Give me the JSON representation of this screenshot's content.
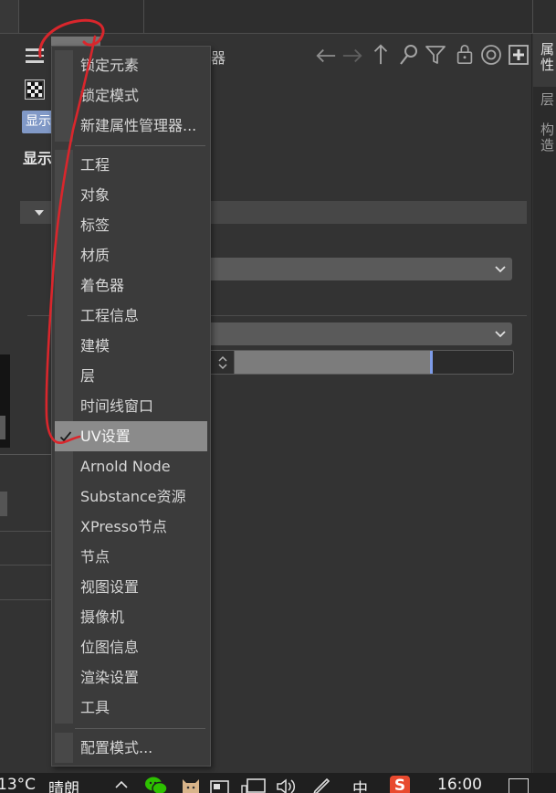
{
  "side_tabs": {
    "attributes": "属性",
    "layers": "层",
    "structure": "构造"
  },
  "toolbar": {
    "title_fragment": "器"
  },
  "mode_button": {
    "label": "显示"
  },
  "section": {
    "heading": "显示"
  },
  "slider": {
    "fill_fraction": 0.7
  },
  "menu": {
    "items": [
      {
        "label": "锁定元素"
      },
      {
        "label": "锁定模式"
      },
      {
        "label": "新建属性管理器..."
      },
      {
        "label": "工程"
      },
      {
        "label": "对象"
      },
      {
        "label": "标签"
      },
      {
        "label": "材质"
      },
      {
        "label": "着色器"
      },
      {
        "label": "工程信息"
      },
      {
        "label": "建模"
      },
      {
        "label": "层"
      },
      {
        "label": "时间线窗口"
      },
      {
        "label": "UV设置",
        "checked": true,
        "highlighted": true
      },
      {
        "label": "Arnold Node"
      },
      {
        "label": "Substance资源"
      },
      {
        "label": "XPresso节点"
      },
      {
        "label": "节点"
      },
      {
        "label": "视图设置"
      },
      {
        "label": "摄像机"
      },
      {
        "label": "位图信息"
      },
      {
        "label": "渲染设置"
      },
      {
        "label": "工具"
      },
      {
        "label": "配置模式..."
      }
    ]
  },
  "taskbar": {
    "temperature": "13°C",
    "weather": "晴朗",
    "ime": "中",
    "time": "16:00",
    "sogou_logo": "S"
  },
  "colors": {
    "background": "#333333",
    "menu_background": "#3b3b3b",
    "menu_highlight": "#8b8b8b",
    "mode_button": "#8199c7",
    "slider_marker": "#7e9ce8",
    "annotation": "#d9262c",
    "wechat": "#2dc100",
    "sogou": "#e84a2f"
  },
  "icons": {
    "menu_button": "hamburger-icon",
    "material_preview": "checkerboard-icon",
    "back": "arrow-left-icon",
    "forward": "arrow-right-icon",
    "up": "arrow-up-icon",
    "search": "search-icon",
    "filter": "filter-icon",
    "lock": "lock-icon",
    "target": "target-icon",
    "new_manager": "new-panel-icon",
    "dropdown": "chevron-down-icon",
    "stepper": "stepper-icon",
    "checked": "checkmark-icon",
    "tray_expand": "chevron-up-icon",
    "wechat": "wechat-icon",
    "cat_app": "cat-icon",
    "device": "device-icon",
    "network": "network-icon",
    "volume": "speaker-icon",
    "pen": "pen-icon",
    "ime_app": "sogou-icon",
    "notifications": "notification-icon"
  }
}
